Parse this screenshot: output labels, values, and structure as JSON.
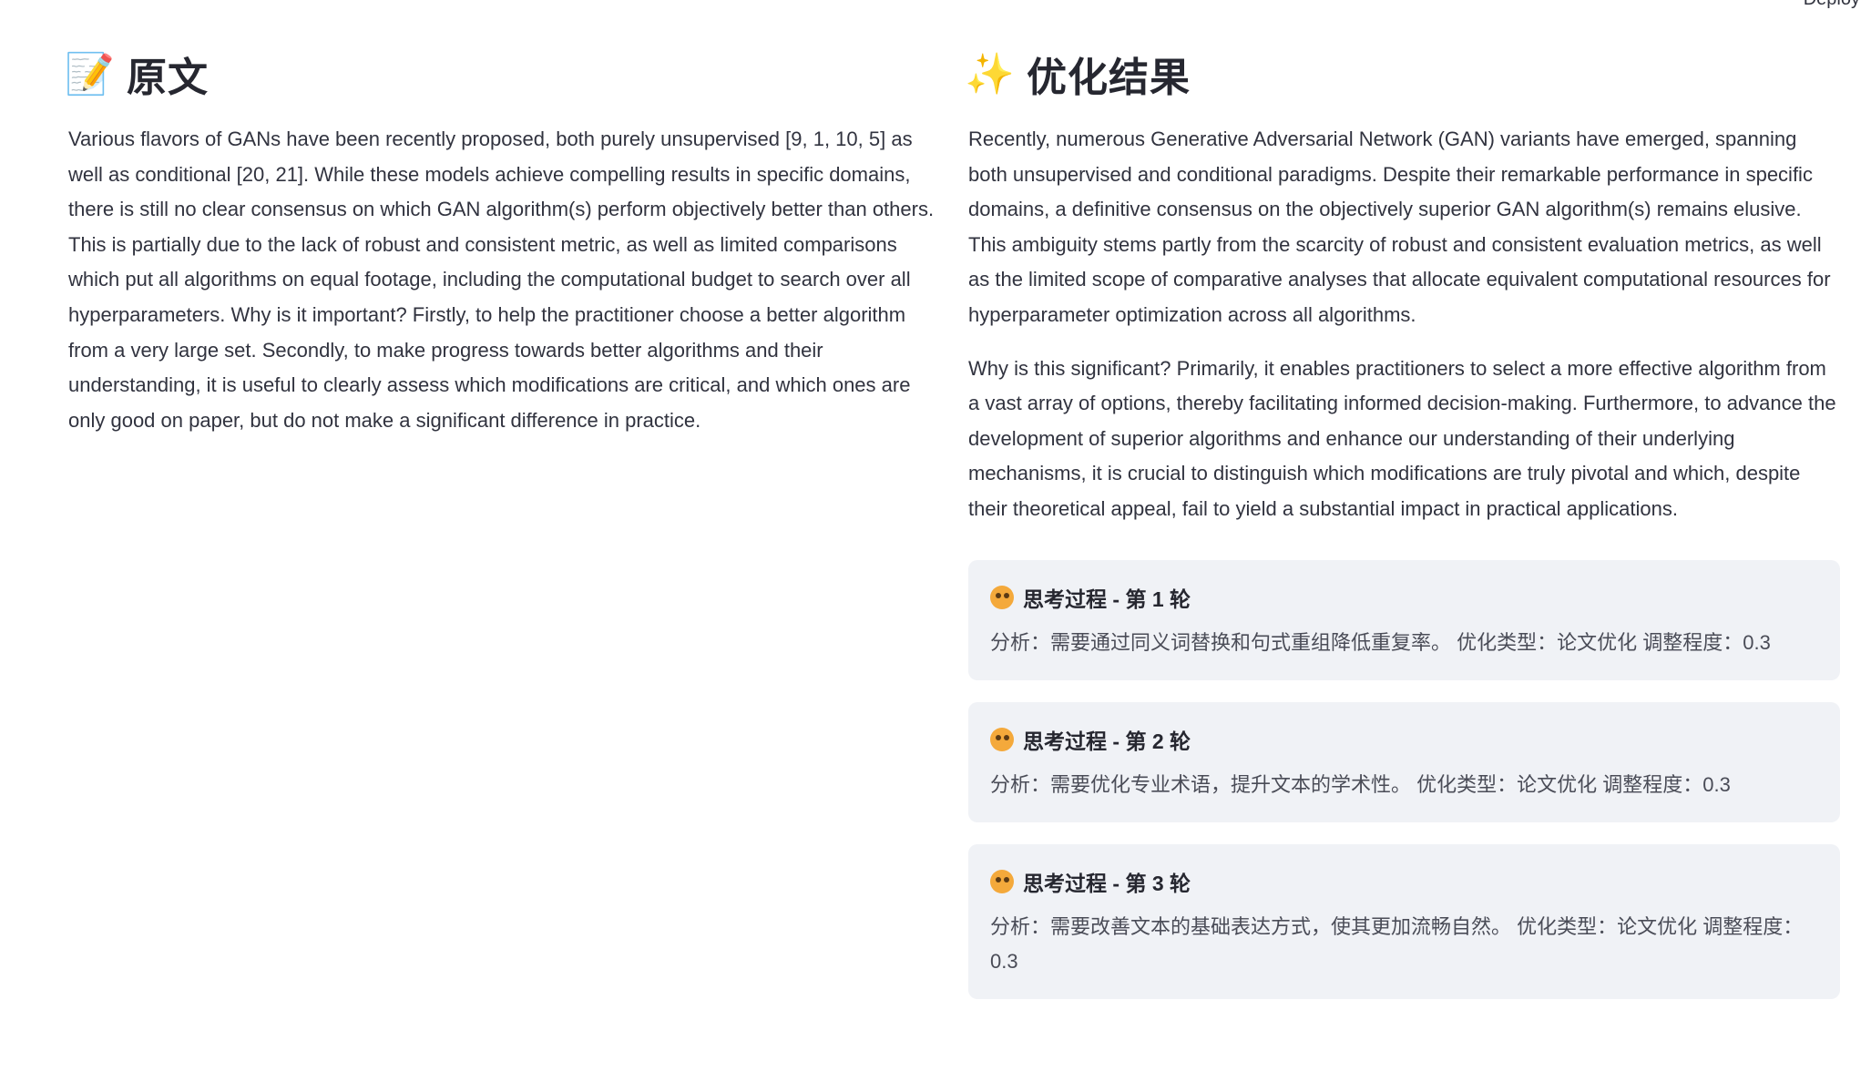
{
  "header": {
    "deploy_label": "Deploy"
  },
  "left": {
    "icon": "memo-icon",
    "title": "原文",
    "text": "Various flavors of GANs have been recently proposed, both purely unsupervised [9, 1, 10, 5] as well as conditional [20, 21]. While these models achieve compelling results in specific domains, there is still no clear consensus on which GAN algorithm(s) perform objectively better than others. This is partially due to the lack of robust and consistent metric, as well as limited comparisons which put all algorithms on equal footage, including the computational budget to search over all hyperparameters. Why is it important? Firstly, to help the practitioner choose a better algorithm from a very large set. Secondly, to make progress towards better algorithms and their understanding, it is useful to clearly assess which modifications are critical, and which ones are only good on paper, but do not make a significant difference in practice."
  },
  "right": {
    "icon": "sparkles-icon",
    "title": "优化结果",
    "paragraphs": [
      "Recently, numerous Generative Adversarial Network (GAN) variants have emerged, spanning both unsupervised and conditional paradigms. Despite their remarkable performance in specific domains, a definitive consensus on the objectively superior GAN algorithm(s) remains elusive. This ambiguity stems partly from the scarcity of robust and consistent evaluation metrics, as well as the limited scope of comparative analyses that allocate equivalent computational resources for hyperparameter optimization across all algorithms.",
      "Why is this significant? Primarily, it enables practitioners to select a more effective algorithm from a vast array of options, thereby facilitating informed decision-making. Furthermore, to advance the development of superior algorithms and enhance our understanding of their underlying mechanisms, it is crucial to distinguish which modifications are truly pivotal and which, despite their theoretical appeal, fail to yield a substantial impact in practical applications."
    ],
    "thinking": [
      {
        "title": "思考过程 - 第 1 轮",
        "text": "分析：需要通过同义词替换和句式重组降低重复率。 优化类型：论文优化 调整程度：0.3"
      },
      {
        "title": "思考过程 - 第 2 轮",
        "text": "分析：需要优化专业术语，提升文本的学术性。 优化类型：论文优化 调整程度：0.3"
      },
      {
        "title": "思考过程 - 第 3 轮",
        "text": "分析：需要改善文本的基础表达方式，使其更加流畅自然。 优化类型：论文优化 调整程度：0.3"
      }
    ]
  }
}
